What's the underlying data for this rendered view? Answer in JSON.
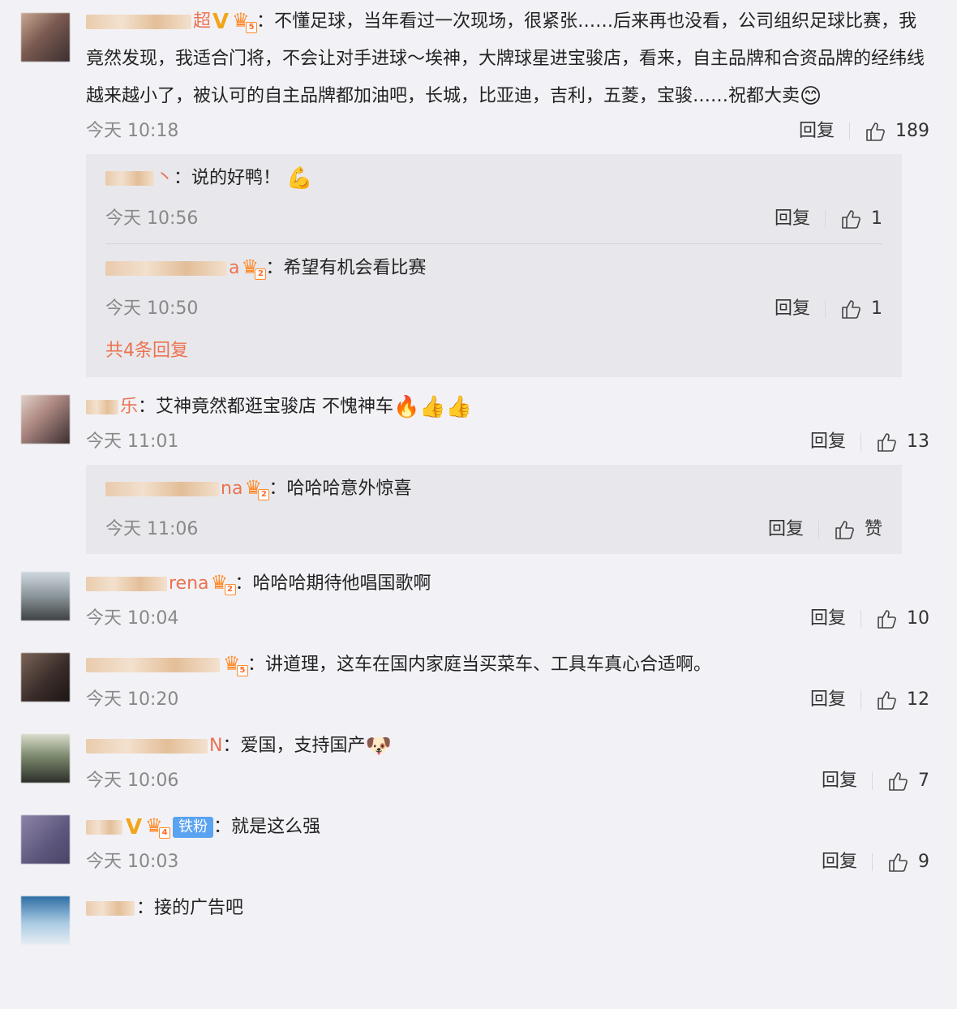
{
  "labels": {
    "reply": "回复",
    "colon": "："
  },
  "comments": [
    {
      "name_visible": "超",
      "text": "不懂足球，当年看过一次现场，很紧张……后来再也没看，公司组织足球比赛，我竟然发现，我适合门将，不会让对手进球～埃神，大牌球星进宝骏店，看来，自主品牌和合资品牌的经纬线越来越小了，被认可的自主品牌都加油吧，长城，比亚迪，吉利，五菱，宝骏……祝都大卖",
      "crown_level": "5",
      "time": "今天 10:18",
      "likes": "189",
      "replies": [
        {
          "name_visible": "丶",
          "text": "说的好鸭！",
          "time": "今天 10:56",
          "likes": "1"
        },
        {
          "name_visible": "a",
          "text": "希望有机会看比赛",
          "crown_level": "2",
          "time": "今天 10:50",
          "likes": "1"
        }
      ],
      "more": "共4条回复"
    },
    {
      "name_visible": "乐",
      "text": "艾神竟然都逛宝骏店  不愧神车",
      "time": "今天 11:01",
      "likes": "13",
      "replies": [
        {
          "name_visible": "na",
          "text": "哈哈哈意外惊喜",
          "crown_level": "2",
          "time": "今天 11:06",
          "likes": "赞"
        }
      ]
    },
    {
      "name_visible": "rena",
      "text": "哈哈哈期待他唱国歌啊",
      "crown_level": "2",
      "time": "今天 10:04",
      "likes": "10"
    },
    {
      "name_visible": "",
      "text": "讲道理，这车在国内家庭当买菜车、工具车真心合适啊。",
      "crown_level": "5",
      "time": "今天 10:20",
      "likes": "12"
    },
    {
      "name_visible": "N",
      "text": "爱国，支持国产",
      "time": "今天 10:06",
      "likes": "7"
    },
    {
      "name_visible": "",
      "text": "就是这么强",
      "crown_level": "4",
      "fan_badge": "铁粉",
      "time": "今天 10:03",
      "likes": "9"
    },
    {
      "name_visible": "",
      "text": "接的广告吧"
    }
  ],
  "colors": {
    "username": "#eb7350",
    "vip": "#f2a51a",
    "fan_badge": "#5aa3f0",
    "background": "#f2f2f6",
    "reply_bg": "#e8e8ec"
  },
  "icons": [
    "thumbs-up-icon",
    "v-badge-icon",
    "crown-icon",
    "smile-emoji",
    "muscle-emoji",
    "fire-emoji",
    "thumbs-up-emoji",
    "doge-emoji"
  ]
}
